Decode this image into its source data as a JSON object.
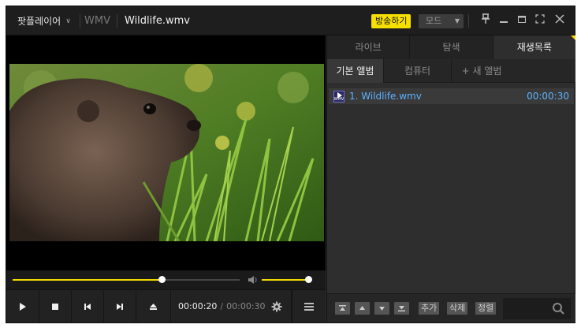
{
  "titlebar": {
    "app_name": "팟플레이어",
    "format": "WMV",
    "filename": "Wildlife.wmv",
    "broadcast_label": "방송하기",
    "mode_label": "모드"
  },
  "player": {
    "seek_progress": 0.657,
    "volume_level": 0.92,
    "current_time": "00:00:20",
    "time_separator": "/",
    "total_time": "00:00:30"
  },
  "panel": {
    "tabs": [
      {
        "label": "라이브"
      },
      {
        "label": "탐색"
      },
      {
        "label": "재생목록"
      }
    ],
    "subtabs": [
      {
        "label": "기본 앨범"
      },
      {
        "label": "컴퓨터"
      },
      {
        "label": "+ 새 앨범"
      }
    ],
    "playlist": [
      {
        "title": "1. Wildlife.wmv",
        "duration": "00:00:30",
        "icon_label": "WMV"
      }
    ],
    "toolbar": {
      "add_label": "추가",
      "delete_label": "삭제",
      "sort_label": "정렬"
    }
  },
  "colors": {
    "accent": "#f3d900",
    "link": "#5ab3ff",
    "background": "#2b2b2b"
  },
  "icons": [
    "chevron-down-icon",
    "pin-icon",
    "minimize-icon",
    "maximize-icon",
    "fullscreen-icon",
    "close-icon",
    "volume-icon",
    "play-icon",
    "stop-icon",
    "previous-icon",
    "next-icon",
    "eject-icon",
    "gear-icon",
    "menu-icon",
    "move-top-icon",
    "move-up-icon",
    "move-down-icon",
    "move-bottom-icon",
    "search-icon"
  ]
}
